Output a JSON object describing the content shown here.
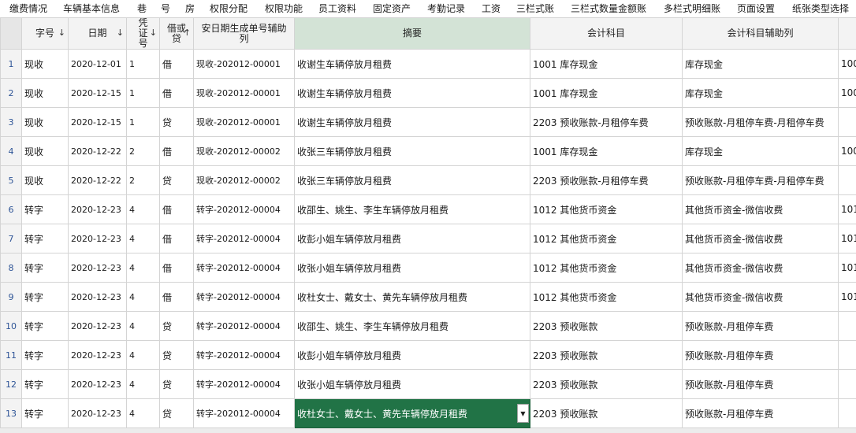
{
  "menu": [
    "缴费情况",
    "车辆基本信息",
    "巷",
    "号",
    "房",
    "权限分配",
    "权限功能",
    "员工资料",
    "固定资产",
    "考勤记录",
    "工资",
    "三栏式账",
    "三栏式数量金额账",
    "多栏式明细账",
    "页面设置",
    "纸张类型选择"
  ],
  "columns": [
    {
      "label": "字号",
      "arrow": "↓"
    },
    {
      "label": "日期",
      "arrow": "↓"
    },
    {
      "label": "凭证号",
      "arrow": "↓"
    },
    {
      "label": "借或贷",
      "arrow": "↑"
    },
    {
      "label": "安日期生成单号辅助列",
      "arrow": ""
    },
    {
      "label": "摘要",
      "arrow": ""
    },
    {
      "label": "会计科目",
      "arrow": ""
    },
    {
      "label": "会计科目辅助列",
      "arrow": ""
    }
  ],
  "rows": [
    {
      "num": "1",
      "zi": "现收",
      "date": "2020-12-01",
      "voucher": "1",
      "jd": "借",
      "aux": "现收-202012-00001",
      "summary": "收谢生车辆停放月租费",
      "account": "1001  库存现金",
      "account_aux": "库存现金",
      "extra": "100"
    },
    {
      "num": "2",
      "zi": "现收",
      "date": "2020-12-15",
      "voucher": "1",
      "jd": "借",
      "aux": "现收-202012-00001",
      "summary": "收谢生车辆停放月租费",
      "account": "1001  库存现金",
      "account_aux": "库存现金",
      "extra": "100"
    },
    {
      "num": "3",
      "zi": "现收",
      "date": "2020-12-15",
      "voucher": "1",
      "jd": "贷",
      "aux": "现收-202012-00001",
      "summary": "收谢生车辆停放月租费",
      "account": "2203  预收账款-月租停车费",
      "account_aux": "预收账款-月租停车费-月租停车费",
      "extra": ""
    },
    {
      "num": "4",
      "zi": "现收",
      "date": "2020-12-22",
      "voucher": "2",
      "jd": "借",
      "aux": "现收-202012-00002",
      "summary": "收张三车辆停放月租费",
      "account": "1001  库存现金",
      "account_aux": "库存现金",
      "extra": "100"
    },
    {
      "num": "5",
      "zi": "现收",
      "date": "2020-12-22",
      "voucher": "2",
      "jd": "贷",
      "aux": "现收-202012-00002",
      "summary": "收张三车辆停放月租费",
      "account": "2203  预收账款-月租停车费",
      "account_aux": "预收账款-月租停车费-月租停车费",
      "extra": ""
    },
    {
      "num": "6",
      "zi": "转字",
      "date": "2020-12-23",
      "voucher": "4",
      "jd": "借",
      "aux": "转字-202012-00004",
      "summary": "收邵生、姚生、李生车辆停放月租费",
      "account": "1012  其他货币资金",
      "account_aux": "其他货币资金-微信收费",
      "extra": "101:"
    },
    {
      "num": "7",
      "zi": "转字",
      "date": "2020-12-23",
      "voucher": "4",
      "jd": "借",
      "aux": "转字-202012-00004",
      "summary": "收彭小姐车辆停放月租费",
      "account": "1012  其他货币资金",
      "account_aux": "其他货币资金-微信收费",
      "extra": "101:"
    },
    {
      "num": "8",
      "zi": "转字",
      "date": "2020-12-23",
      "voucher": "4",
      "jd": "借",
      "aux": "转字-202012-00004",
      "summary": "收张小姐车辆停放月租费",
      "account": "1012  其他货币资金",
      "account_aux": "其他货币资金-微信收费",
      "extra": "101:"
    },
    {
      "num": "9",
      "zi": "转字",
      "date": "2020-12-23",
      "voucher": "4",
      "jd": "借",
      "aux": "转字-202012-00004",
      "summary": "收杜女士、戴女士、黄先车辆停放月租费",
      "account": "1012  其他货币资金",
      "account_aux": "其他货币资金-微信收费",
      "extra": "101:"
    },
    {
      "num": "10",
      "zi": "转字",
      "date": "2020-12-23",
      "voucher": "4",
      "jd": "贷",
      "aux": "转字-202012-00004",
      "summary": "收邵生、姚生、李生车辆停放月租费",
      "account": "2203  预收账款",
      "account_aux": "预收账款-月租停车费",
      "extra": ""
    },
    {
      "num": "11",
      "zi": "转字",
      "date": "2020-12-23",
      "voucher": "4",
      "jd": "贷",
      "aux": "转字-202012-00004",
      "summary": "收彭小姐车辆停放月租费",
      "account": "2203  预收账款",
      "account_aux": "预收账款-月租停车费",
      "extra": ""
    },
    {
      "num": "12",
      "zi": "转字",
      "date": "2020-12-23",
      "voucher": "4",
      "jd": "贷",
      "aux": "转字-202012-00004",
      "summary": "收张小姐车辆停放月租费",
      "account": "2203  预收账款",
      "account_aux": "预收账款-月租停车费",
      "extra": ""
    },
    {
      "num": "13",
      "zi": "转字",
      "date": "2020-12-23",
      "voucher": "4",
      "jd": "贷",
      "aux": "转字-202012-00004",
      "summary": "收杜女士、戴女士、黄先车辆停放月租费",
      "account": "2203  预收账款",
      "account_aux": "预收账款-月租停车费",
      "extra": ""
    }
  ],
  "active_cell": {
    "row": 13,
    "column": "摘要"
  },
  "colors": {
    "active_fill": "#217346",
    "header_highlight": "#d3e3d6",
    "row_number": "#2f5597"
  },
  "icons": {
    "active_cell_dropdown": "dropdown-arrow-icon"
  }
}
